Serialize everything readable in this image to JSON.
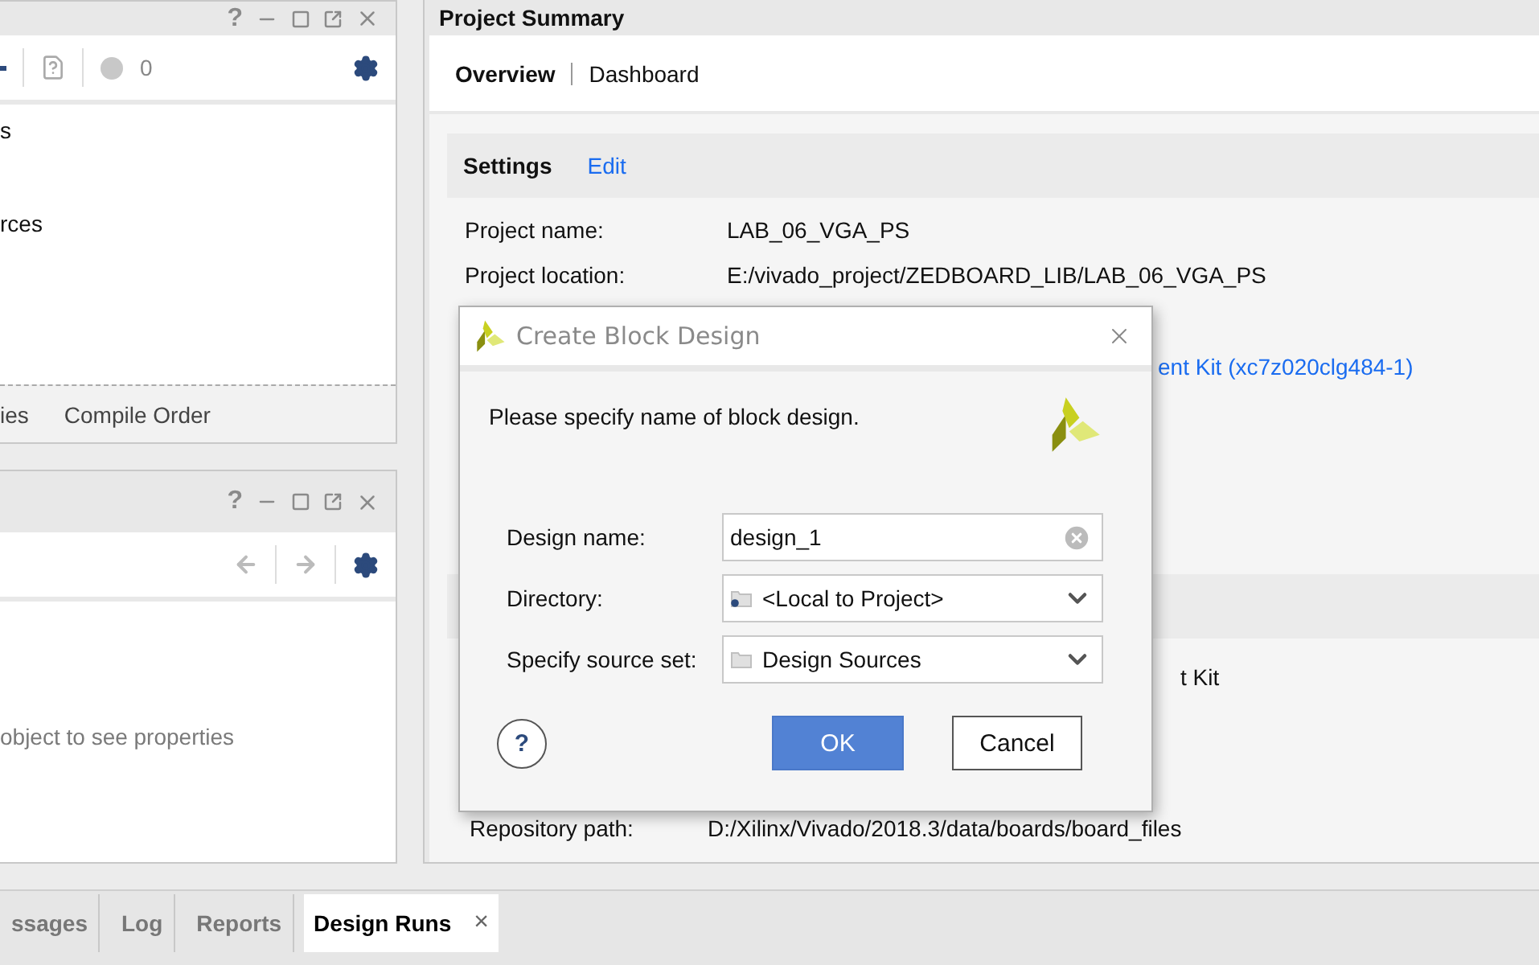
{
  "sources_panel": {
    "help": "?",
    "count": "0",
    "items": [
      "s",
      "rces"
    ],
    "tabs": [
      {
        "label": "ies",
        "selected": false
      },
      {
        "label": "Compile Order",
        "selected": false
      }
    ]
  },
  "properties_panel": {
    "help": "?",
    "message": "object to see properties"
  },
  "project_summary": {
    "title": "Project Summary",
    "tabs": [
      {
        "label": "Overview",
        "selected": true
      },
      {
        "label": "Dashboard",
        "selected": false
      }
    ],
    "sections": [
      {
        "title": "Settings",
        "action": "Edit",
        "rows": [
          {
            "kind": "text",
            "label": "Project name:",
            "value": "LAB_06_VGA_PS"
          },
          {
            "kind": "text",
            "label": "Project location:",
            "value": "E:/vivado_project/ZEDBOARD_LIB/LAB_06_VGA_PS"
          },
          {
            "kind": "tail",
            "value": "ent Kit (xc7z020clg484-1)",
            "link": true
          }
        ]
      },
      {
        "rows": [
          {
            "kind": "tail",
            "value": "t Kit",
            "link": false
          },
          {
            "kind": "below",
            "label": "Repository path:",
            "value": "D:/Xilinx/Vivado/2018.3/data/boards/board_files"
          }
        ]
      }
    ]
  },
  "dialog": {
    "title": "Create Block Design",
    "message": "Please specify name of block design.",
    "fields": [
      {
        "kind": "text",
        "label": "Design name:",
        "value": "design_1"
      },
      {
        "kind": "select",
        "label": "Directory:",
        "value": "<Local to Project>"
      },
      {
        "kind": "select",
        "label": "Specify source set:",
        "value": "Design Sources"
      }
    ],
    "help": "?",
    "ok": "OK",
    "cancel": "Cancel"
  },
  "bottom_tabs": [
    {
      "label": "ssages",
      "selected": false
    },
    {
      "label": "Log",
      "selected": false
    },
    {
      "label": "Reports",
      "selected": false
    },
    {
      "label": "Design Runs",
      "selected": true,
      "close": "×"
    }
  ]
}
